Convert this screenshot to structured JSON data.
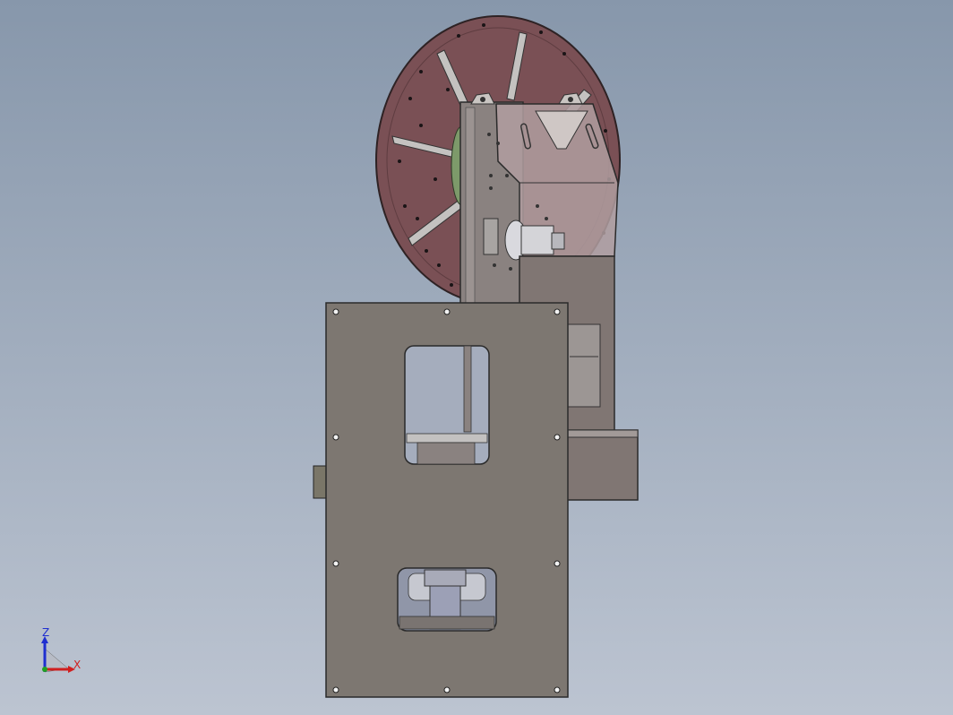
{
  "viewport": {
    "background_top": "#8797ab",
    "background_bottom": "#bcc4d1"
  },
  "model": {
    "reel_color": "#7a5055",
    "plate_color": "#7d7771",
    "frame_color": "#807673",
    "hub_color": "#7d9a6a",
    "glass_color": "#b09ea0"
  },
  "triad": {
    "z_label": "Z",
    "x_label": "X",
    "z_color": "#1f2fd0",
    "x_color": "#d01f1f",
    "y_color": "#20a020"
  }
}
